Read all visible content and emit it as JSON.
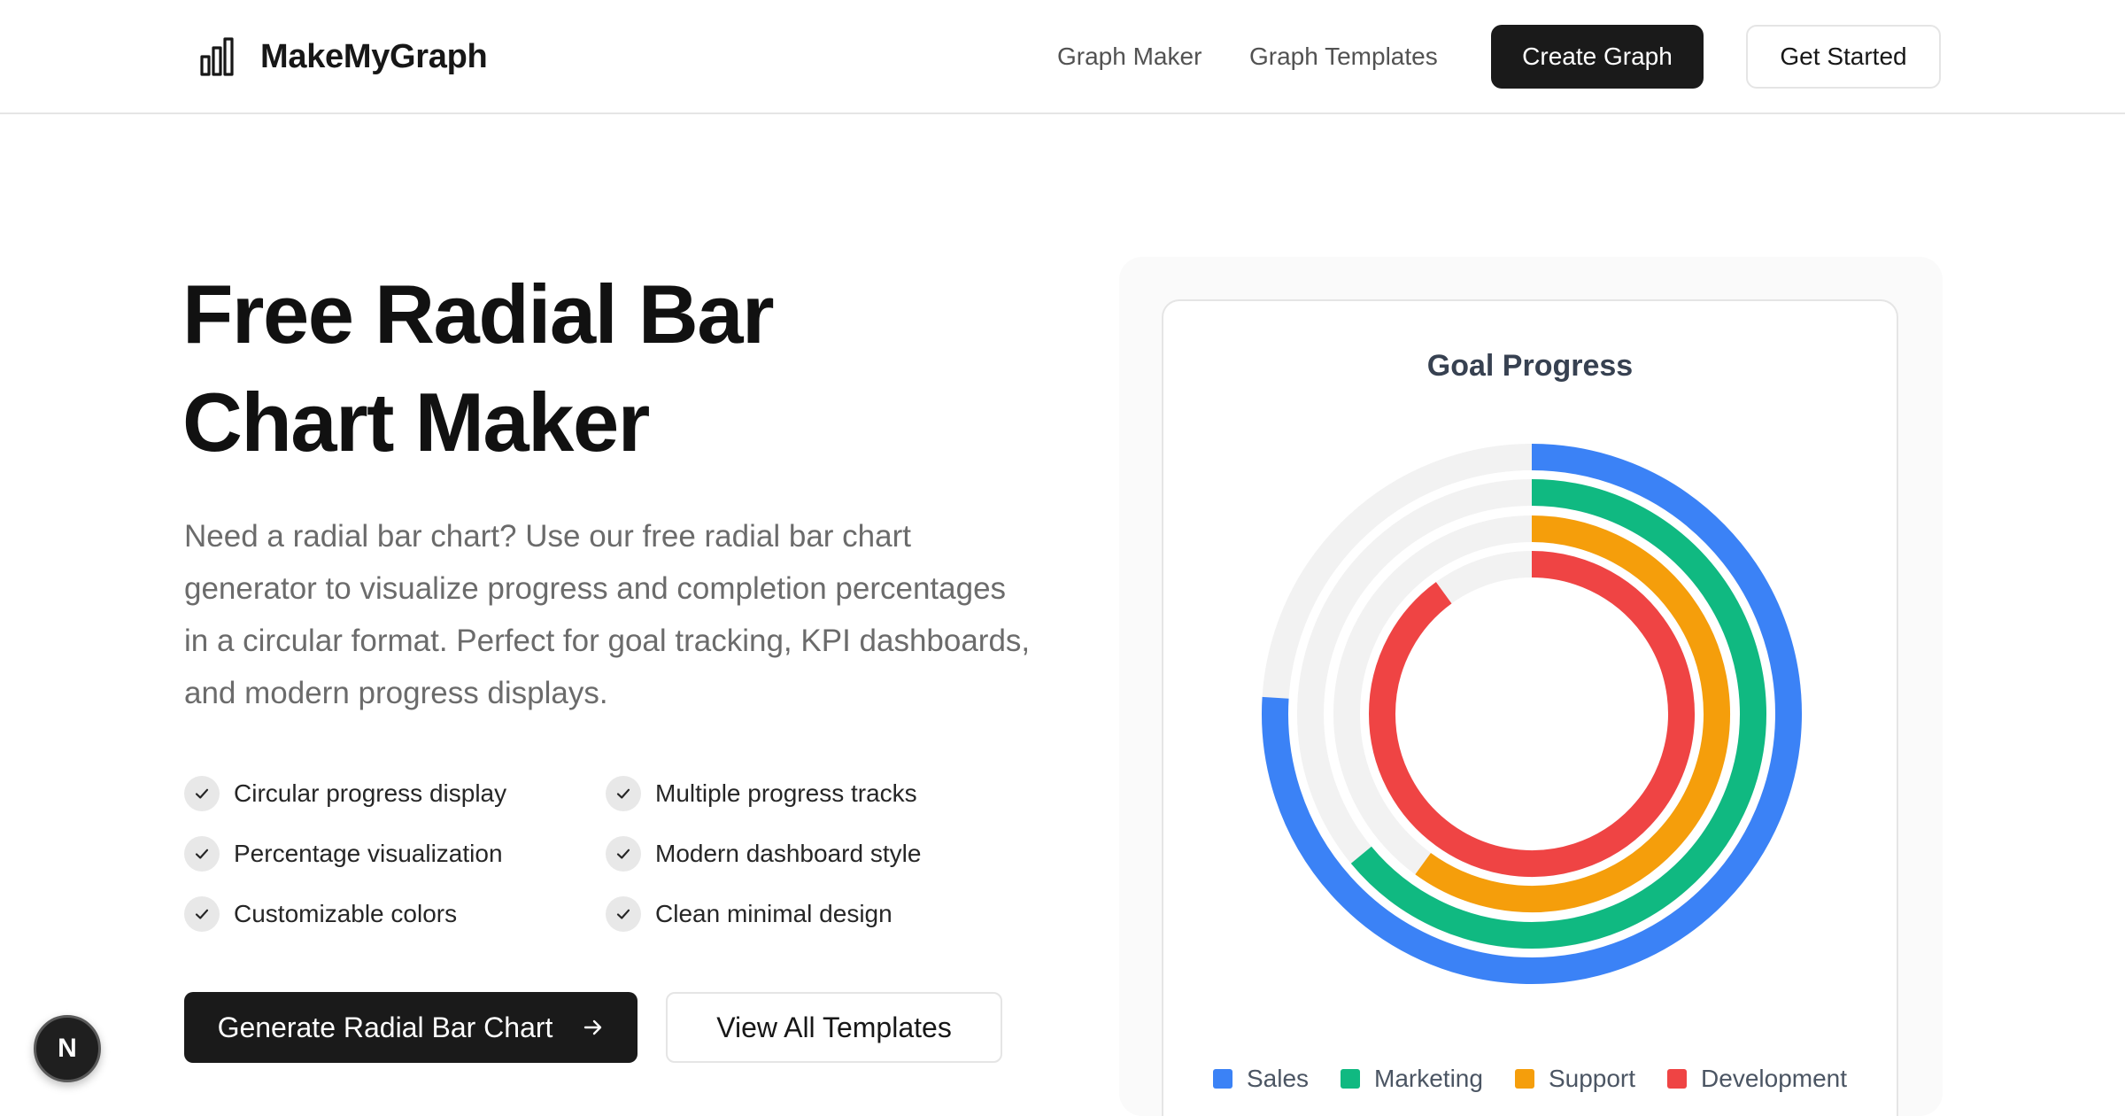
{
  "header": {
    "brand_name": "MakeMyGraph",
    "nav": [
      {
        "label": "Graph Maker"
      },
      {
        "label": "Graph Templates"
      }
    ],
    "create_label": "Create Graph",
    "get_started_label": "Get Started"
  },
  "hero": {
    "title_line1": "Free Radial Bar",
    "title_line2": "Chart Maker",
    "description": "Need a radial bar chart? Use our free radial bar chart generator to visualize progress and completion percentages in a circular format. Perfect for goal tracking, KPI dashboards, and modern progress displays.",
    "features": [
      {
        "label": "Circular progress display"
      },
      {
        "label": "Multiple progress tracks"
      },
      {
        "label": "Percentage visualization"
      },
      {
        "label": "Modern dashboard style"
      },
      {
        "label": "Customizable colors"
      },
      {
        "label": "Clean minimal design"
      }
    ],
    "primary_cta": "Generate Radial Bar Chart",
    "secondary_cta": "View All Templates"
  },
  "badge": {
    "letter": "N"
  },
  "colors": {
    "sales": "#3b82f6",
    "marketing": "#10b981",
    "support": "#f59e0b",
    "development": "#ef4444",
    "track": "#f2f2f2"
  },
  "chart_data": {
    "type": "radialBar",
    "title": "Goal Progress",
    "max": 100,
    "series": [
      {
        "name": "Sales",
        "value": 76,
        "color": "#3b82f6"
      },
      {
        "name": "Marketing",
        "value": 64,
        "color": "#10b981"
      },
      {
        "name": "Support",
        "value": 60,
        "color": "#f59e0b"
      },
      {
        "name": "Development",
        "value": 90,
        "color": "#ef4444"
      }
    ],
    "legend_position": "bottom"
  }
}
